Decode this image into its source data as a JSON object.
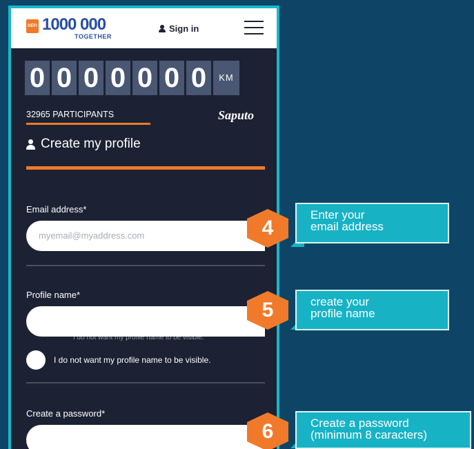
{
  "header": {
    "logo_badge": "DÉFI",
    "logo_number": "1000 000",
    "logo_subtitle": "TOGETHER",
    "signin_label": "Sign in"
  },
  "counter": {
    "digits": [
      "0",
      "0",
      "0",
      "0",
      "0",
      "0",
      "0"
    ],
    "unit": "KM",
    "participants": "32965 PARTICIPANTS",
    "sponsor": "Saputo"
  },
  "form": {
    "title": "Create my profile",
    "email_label": "Email address*",
    "email_placeholder": "myemail@myaddress.com",
    "profile_label": "Profile name*",
    "profile_hint_ghost": "I do not want my profile name to be visible.",
    "visibility_label": "I do not want my profile name to be visible.",
    "password_label": "Create a password*"
  },
  "callouts": [
    {
      "number": "4",
      "text_line1": "Enter your",
      "text_line2": "email address"
    },
    {
      "number": "5",
      "text_line1": "create your",
      "text_line2": "profile name"
    },
    {
      "number": "6",
      "text_line1": "Create a password",
      "text_line2": "(minimum 8 caracters)"
    }
  ],
  "colors": {
    "background": "#0e4566",
    "app_background": "#1c2233",
    "accent_orange": "#f07a2a",
    "callout_teal": "#17b3c5",
    "frame_teal": "#19b7c9"
  },
  "icons": {
    "menu": "hamburger-icon",
    "user": "user-icon"
  }
}
